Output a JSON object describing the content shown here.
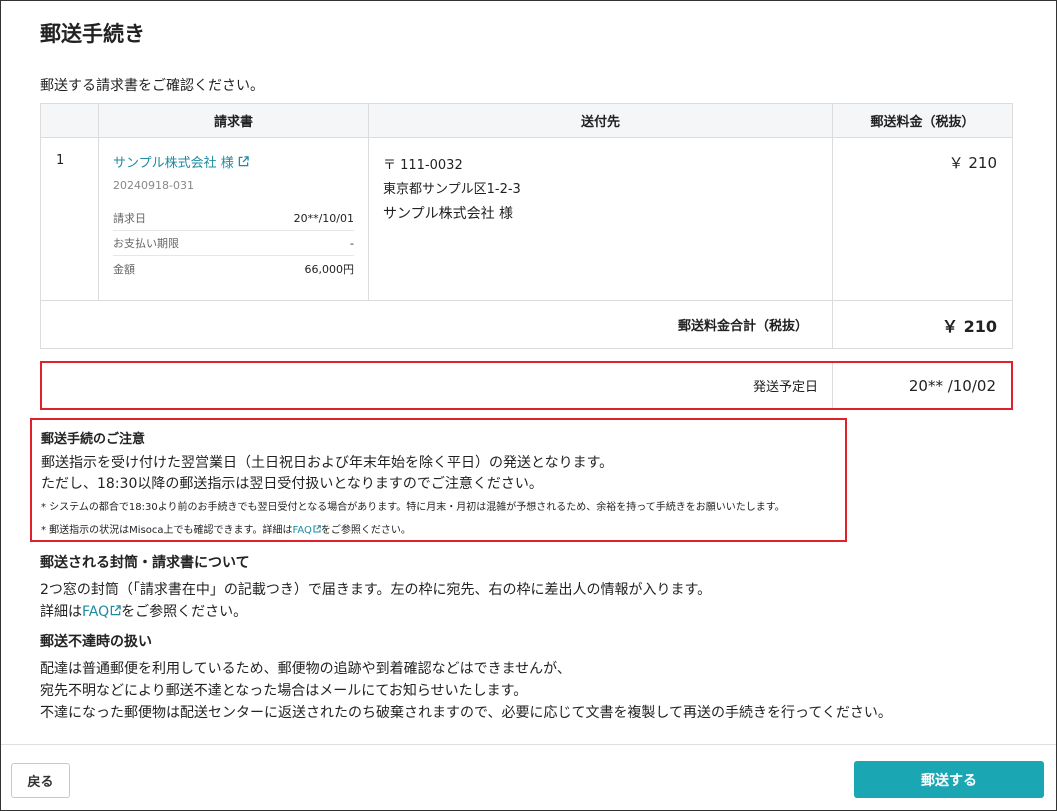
{
  "title": "郵送手続き",
  "lead": "郵送する請求書をご確認ください。",
  "table": {
    "headers": [
      "",
      "請求書",
      "送付先",
      "郵送料金（税抜）"
    ],
    "rows": [
      {
        "num": "1",
        "invoice_name": "サンプル株式会社 様",
        "invoice_no": "20240918-031",
        "details": [
          {
            "key": "請求日",
            "value": "20**/10/01"
          },
          {
            "key": "お支払い期限",
            "value": "-"
          },
          {
            "key": "金額",
            "value": "66,000円"
          }
        ],
        "address": {
          "zip": "〒 111-0032",
          "line": "東京都サンプル区1-2-3",
          "name": "サンプル株式会社 様"
        },
        "fee": "￥ 210"
      }
    ],
    "total_label": "郵送料金合計（税抜）",
    "total_value": "￥ 210"
  },
  "ship": {
    "label": "発送予定日",
    "value": "20** /10/02"
  },
  "notice": {
    "heading": "郵送手続のご注意",
    "line1": "郵送指示を受け付けた翌営業日（土日祝日および年末年始を除く平日）の発送となります。",
    "line2": "ただし、18:30以降の郵送指示は翌日受付扱いとなりますのでご注意ください。",
    "note1": "* システムの都合で18:30より前のお手続きでも翌日受付となる場合があります。特に月末・月初は混雑が予想されるため、余裕を持って手続きをお願いいたします。",
    "note2_pre": "* 郵送指示の状況はMisoca上でも確認できます。詳細は",
    "note2_link": "FAQ",
    "note2_post": "をご参照ください。"
  },
  "envelope": {
    "heading": "郵送される封筒・請求書について",
    "line1": "2つ窓の封筒（「請求書在中」の記載つき）で届きます。左の枠に宛先、右の枠に差出人の情報が入ります。",
    "line2_pre": "詳細は",
    "line2_link": "FAQ",
    "line2_post": "をご参照ください。"
  },
  "undelivered": {
    "heading": "郵送不達時の扱い",
    "line1": "配達は普通郵便を利用しているため、郵便物の追跡や到着確認などはできませんが、",
    "line2": "宛先不明などにより郵送不達となった場合はメールにてお知らせいたします。",
    "line3": "不達になった郵便物は配送センターに返送されたのち破棄されますので、必要に応じて文書を複製して再送の手続きを行ってください。"
  },
  "footer": {
    "back_label": "戻る",
    "send_label": "郵送する"
  },
  "colors": {
    "accent": "#1ba6b3",
    "link": "#1e8ca0",
    "highlight_border": "#e0202a"
  }
}
